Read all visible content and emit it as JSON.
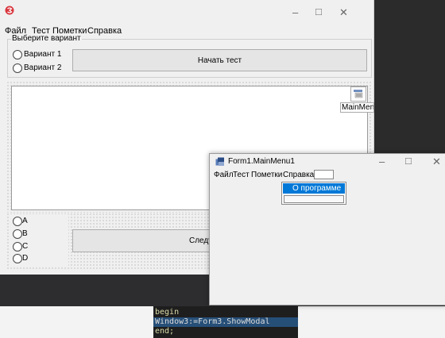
{
  "main_window": {
    "menu": [
      "Файл",
      "Тест",
      "Пометки",
      "Справка"
    ],
    "group_caption": "Выберите вариант",
    "variants": [
      "Вариант 1",
      "Вариант 2"
    ],
    "start_button": "Начать тест",
    "main_menu_component_label": "MainMenu",
    "answers": [
      "A",
      "B",
      "C",
      "D"
    ],
    "next_button": "Следу"
  },
  "sub_window": {
    "title": "Form1.MainMenu1",
    "menu": [
      "Файл",
      "Тест",
      "Пометки",
      "Справка"
    ],
    "dropdown_item": "О программе"
  },
  "code": {
    "lines": [
      "begin",
      "Window3:=Form3.ShowModal",
      "end;"
    ]
  },
  "window_controls": {
    "minimize": "–",
    "maximize": "□",
    "close": "✕"
  },
  "colors": {
    "selection": "#0078d7",
    "ide_dark": "#2b2b2b",
    "accent_icon": "#d9363e"
  }
}
